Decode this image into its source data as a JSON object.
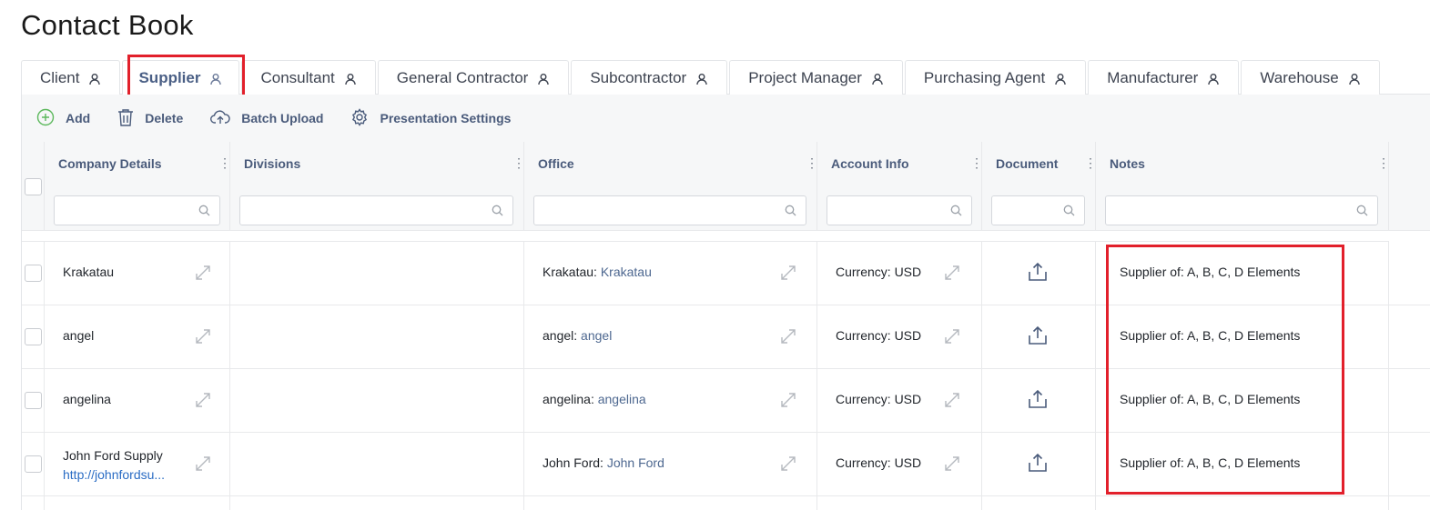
{
  "page_title": "Contact Book",
  "tabs": [
    {
      "label": "Client",
      "active": false
    },
    {
      "label": "Supplier",
      "active": true
    },
    {
      "label": "Consultant",
      "active": false
    },
    {
      "label": "General Contractor",
      "active": false
    },
    {
      "label": "Subcontractor",
      "active": false
    },
    {
      "label": "Project Manager",
      "active": false
    },
    {
      "label": "Purchasing Agent",
      "active": false
    },
    {
      "label": "Manufacturer",
      "active": false
    },
    {
      "label": "Warehouse",
      "active": false
    }
  ],
  "toolbar": {
    "add_label": "Add",
    "delete_label": "Delete",
    "batch_upload_label": "Batch Upload",
    "presentation_settings_label": "Presentation Settings"
  },
  "columns": {
    "company_details": "Company Details",
    "divisions": "Divisions",
    "office": "Office",
    "account_info": "Account Info",
    "document": "Document",
    "notes": "Notes"
  },
  "rows": [
    {
      "company": "Krakatau",
      "company_url": "",
      "office_prefix": "Krakatau:",
      "office_link": "Krakatau",
      "account": "Currency: USD",
      "notes": "Supplier of: A, B, C, D Elements"
    },
    {
      "company": "angel",
      "company_url": "",
      "office_prefix": "angel:",
      "office_link": "angel",
      "account": "Currency: USD",
      "notes": "Supplier of: A, B, C, D Elements"
    },
    {
      "company": "angelina",
      "company_url": "",
      "office_prefix": "angelina:",
      "office_link": "angelina",
      "account": "Currency: USD",
      "notes": "Supplier of: A, B, C, D Elements"
    },
    {
      "company": "John Ford Supply",
      "company_url": "http://johnfordsu...",
      "office_prefix": "John Ford:",
      "office_link": "John Ford",
      "account": "Currency: USD",
      "notes": "Supplier of: A, B, C, D Elements"
    }
  ],
  "colors": {
    "highlight": "#e2202b",
    "header_text": "#4a5b7b",
    "link": "#4e6890",
    "url": "#2a6cc4",
    "add_icon": "#5cb85c"
  }
}
